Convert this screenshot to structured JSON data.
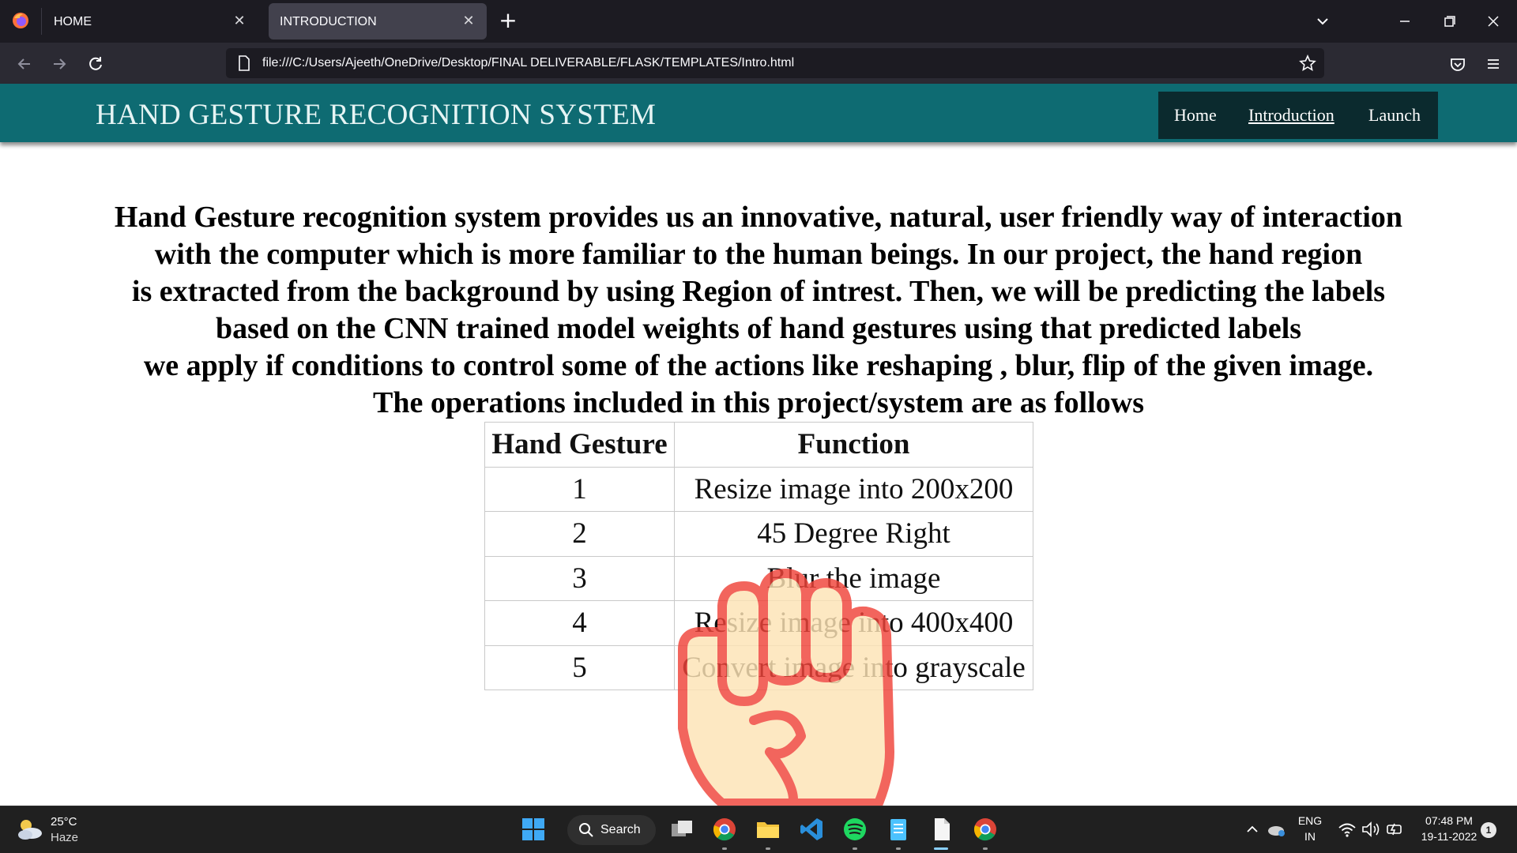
{
  "browser": {
    "tabs": [
      {
        "label": "HOME",
        "active": false
      },
      {
        "label": "INTRODUCTION",
        "active": true
      }
    ],
    "url": "file:///C:/Users/Ajeeth/OneDrive/Desktop/FINAL DELIVERABLE/FLASK/TEMPLATES/Intro.html"
  },
  "header": {
    "title": "HAND GESTURE RECOGNITION SYSTEM",
    "nav": [
      {
        "label": "Home"
      },
      {
        "label": "Introduction",
        "active": true
      },
      {
        "label": "Launch"
      }
    ]
  },
  "main": {
    "intro_lines": [
      "Hand Gesture recognition system provides us an innovative, natural, user friendly way of interaction",
      "with the computer which is more familiar to the human beings. In our project, the hand region",
      "is extracted from the background by using Region of intrest. Then, we will be predicting the labels",
      "based on the CNN trained model weights of hand gestures using that predicted labels",
      "we apply if conditions to control some of the actions like reshaping , blur, flip of the given image.",
      "The operations included in this project/system are as follows"
    ],
    "table": {
      "headers": [
        "Hand Gesture",
        "Function"
      ],
      "rows": [
        [
          "1",
          "Resize image into 200x200"
        ],
        [
          "2",
          "45 Degree Right"
        ],
        [
          "3",
          "Blur the image"
        ],
        [
          "4",
          "Resize image into 400x400"
        ],
        [
          "5",
          "Convert image into grayscale"
        ]
      ]
    },
    "overlay_icon": "fist-icon"
  },
  "taskbar": {
    "weather": {
      "temp": "25°C",
      "desc": "Haze"
    },
    "search_label": "Search",
    "lang": {
      "line1": "ENG",
      "line2": "IN"
    },
    "clock": {
      "time": "07:48 PM",
      "date": "19-11-2022"
    },
    "notification_count": "1"
  },
  "colors": {
    "header_bg": "#0e6b72",
    "nav_bg": "#0b2a2e",
    "fist_outline": "#f0443a",
    "fist_fill": "#fde3b5"
  }
}
